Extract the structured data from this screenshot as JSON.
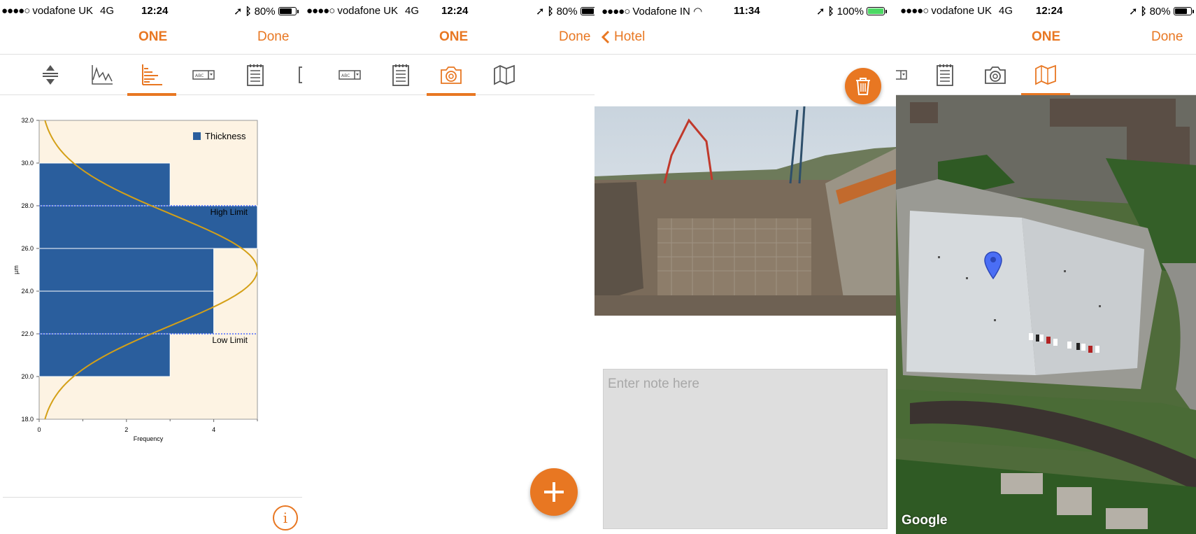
{
  "colors": {
    "accent": "#e87722",
    "chart_bg": "#fdf3e3",
    "bar": "#2a5e9d",
    "curve": "#d4a017",
    "limit_line": "#4d6bff"
  },
  "screens": [
    {
      "status": {
        "carrier": "vodafone UK",
        "network": "4G",
        "time": "12:24",
        "battery": "80%"
      },
      "nav": {
        "title": "ONE",
        "done": "Done"
      },
      "tabs": [
        {
          "icon": "sort-icon"
        },
        {
          "icon": "line-chart-icon"
        },
        {
          "icon": "histogram-icon",
          "active": true
        },
        {
          "icon": "text-dropdown-icon"
        },
        {
          "icon": "notepad-icon"
        },
        {
          "icon": "gauge-probe-icon"
        }
      ],
      "info_label": "i"
    },
    {
      "status": {
        "carrier": "vodafone UK",
        "network": "4G",
        "time": "12:24",
        "battery": "80%"
      },
      "nav": {
        "title": "ONE",
        "done": "Done"
      },
      "tabs": [
        {
          "icon": "text-dropdown-icon"
        },
        {
          "icon": "notepad-icon"
        },
        {
          "icon": "camera-icon",
          "active": true
        },
        {
          "icon": "map-icon"
        }
      ]
    },
    {
      "status": {
        "carrier": "Vodafone IN",
        "time": "11:34",
        "battery": "100%"
      },
      "nav": {
        "back": "Hotel"
      },
      "note_placeholder": "Enter note here"
    },
    {
      "status": {
        "carrier": "vodafone UK",
        "network": "4G",
        "time": "12:24",
        "battery": "80%"
      },
      "nav": {
        "title": "ONE",
        "done": "Done"
      },
      "tabs": [
        {
          "icon": "text-dropdown-icon"
        },
        {
          "icon": "notepad-icon"
        },
        {
          "icon": "camera-icon"
        },
        {
          "icon": "map-icon",
          "active": true
        }
      ],
      "map_attribution": "Google"
    }
  ],
  "chart_data": {
    "type": "bar",
    "orientation": "horizontal",
    "title": "",
    "xlabel": "Frequency",
    "ylabel": "µm",
    "xlim": [
      0,
      5
    ],
    "ylim": [
      18,
      32
    ],
    "x_ticks": [
      "0",
      "2",
      "4"
    ],
    "y_ticks": [
      "18.0",
      "20.0",
      "22.0",
      "24.0",
      "26.0",
      "28.0",
      "30.0",
      "32.0"
    ],
    "legend": {
      "label": "Thickness",
      "position": "top-right"
    },
    "bins": [
      {
        "from": 20,
        "to": 22,
        "count": 3
      },
      {
        "from": 22,
        "to": 24,
        "count": 4
      },
      {
        "from": 24,
        "to": 26,
        "count": 4
      },
      {
        "from": 26,
        "to": 28,
        "count": 5
      },
      {
        "from": 28,
        "to": 30,
        "count": 3
      }
    ],
    "limits": [
      {
        "label": "High Limit",
        "value": 28
      },
      {
        "label": "Low Limit",
        "value": 22
      }
    ],
    "normal_curve": {
      "mean": 25,
      "sd": 2.6,
      "peak": 5
    }
  }
}
